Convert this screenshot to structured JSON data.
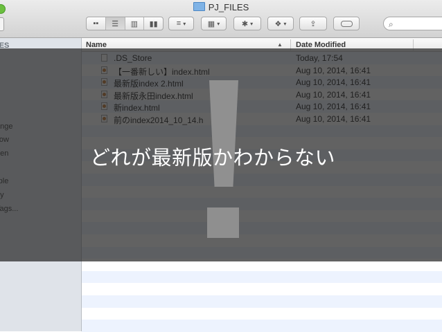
{
  "window": {
    "title": "PJ_FILES"
  },
  "toolbar": {
    "view_icons": [
      "icon-view",
      "list-view",
      "column-view",
      "coverflow-view"
    ],
    "arrange_label": "≡",
    "caret": "▾"
  },
  "sidebar": {
    "header": "TES",
    "items": [
      {
        "label": "s"
      },
      {
        "label": "d"
      },
      {
        "label": "ange"
      },
      {
        "label": "llow"
      },
      {
        "label": "een"
      },
      {
        "label": "e"
      },
      {
        "label": "rple"
      },
      {
        "label": "ay"
      },
      {
        "label": "Tags..."
      }
    ]
  },
  "columns": {
    "name": "Name",
    "date": "Date Modified",
    "sort_arrow": "▲"
  },
  "files": [
    {
      "name": ".DS_Store",
      "date": "Today, 17:54",
      "icon": "blank-file-icon"
    },
    {
      "name": "【一番新しい】index.html",
      "date": "Aug 10, 2014, 16:41",
      "icon": "html-file-icon"
    },
    {
      "name": "最新版index 2.html",
      "date": "Aug 10, 2014, 16:41",
      "icon": "html-file-icon"
    },
    {
      "name": "最新版永田index.html",
      "date": "Aug 10, 2014, 16:41",
      "icon": "html-file-icon"
    },
    {
      "name": "新index.html",
      "date": "Aug 10, 2014, 16:41",
      "icon": "html-file-icon"
    },
    {
      "name": "前のindex2014_10_14.h",
      "date": "Aug 10, 2014, 16:41",
      "icon": "html-file-icon"
    }
  ],
  "overlay": {
    "caption": "どれが最新版かわからない",
    "mark": "!"
  },
  "colors": {
    "overlay": "#262626",
    "accent": "#7fb3e6",
    "alt_row": "#edf3fe"
  }
}
